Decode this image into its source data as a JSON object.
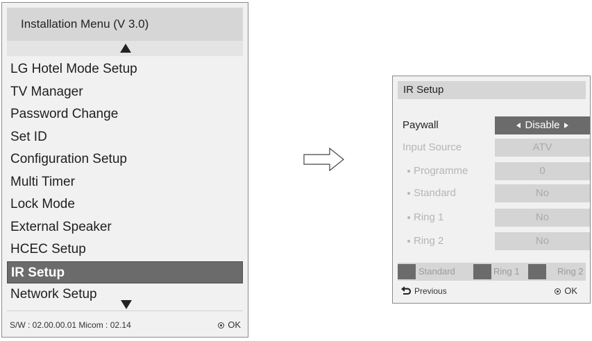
{
  "installation_menu": {
    "title": "Installation Menu (V 3.0)",
    "items": [
      {
        "label": "LG Hotel Mode Setup"
      },
      {
        "label": "TV Manager"
      },
      {
        "label": "Password Change"
      },
      {
        "label": "Set ID"
      },
      {
        "label": "Configuration Setup"
      },
      {
        "label": "Multi Timer"
      },
      {
        "label": "Lock Mode"
      },
      {
        "label": "External Speaker"
      },
      {
        "label": "HCEC Setup"
      },
      {
        "label": "IR Setup",
        "selected": true
      },
      {
        "label": "Network Setup"
      }
    ],
    "footer": {
      "version_text": "S/W : 02.00.00.01 Micom : 02.14",
      "ok_label": "OK"
    }
  },
  "ir_setup": {
    "title": "IR Setup",
    "rows": [
      {
        "label": "Paywall",
        "value": "Disable",
        "active": true
      },
      {
        "label": "Input Source",
        "value": "ATV",
        "active": false
      },
      {
        "label": "Programme",
        "value": "0",
        "active": false
      },
      {
        "label": "Standard",
        "value": "No",
        "active": false
      },
      {
        "label": "Ring 1",
        "value": "No",
        "active": false
      },
      {
        "label": "Ring 2",
        "value": "No",
        "active": false
      }
    ],
    "legend": {
      "standard": "Standard",
      "ring1": "Ring 1",
      "ring2": "Ring 2"
    },
    "previous_label": "Previous",
    "ok_label": "OK"
  },
  "icons": {
    "up": "up-arrow-icon",
    "down": "down-arrow-icon",
    "ok": "ok-button-icon",
    "back": "back-arrow-icon",
    "transition": "right-arrow-icon"
  },
  "colors": {
    "selected_bg": "#6b6b6b",
    "panel_bg": "#f1f1f1",
    "title_bg": "#d6d6d6"
  }
}
